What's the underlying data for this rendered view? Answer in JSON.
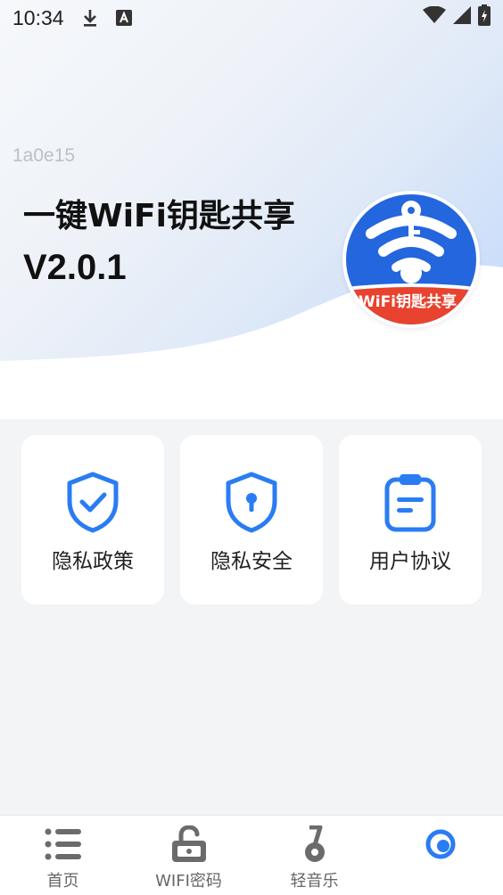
{
  "status_bar": {
    "time": "10:34",
    "icons": [
      "download-icon",
      "a-notification-icon",
      "wifi-icon",
      "signal-icon",
      "battery-icon"
    ]
  },
  "hero": {
    "build_id": "1a0e15",
    "app_title": "一键WiFi钥匙共享",
    "version": "V2.0.1",
    "logo_text": "WiFi钥匙共享"
  },
  "cards": [
    {
      "label": "隐私政策",
      "icon": "shield-check-icon"
    },
    {
      "label": "隐私安全",
      "icon": "shield-lock-icon"
    },
    {
      "label": "用户协议",
      "icon": "clipboard-icon"
    }
  ],
  "bottom_nav": {
    "items": [
      {
        "label": "首页",
        "icon": "list-icon"
      },
      {
        "label": "WIFI密码",
        "icon": "unlock-icon"
      },
      {
        "label": "轻音乐",
        "icon": "music-note-icon"
      },
      {
        "label": "",
        "icon": "profile-ring-icon"
      }
    ]
  },
  "colors": {
    "accent_blue": "#2a7cf3",
    "logo_blue": "#2466dd",
    "logo_red": "#e8432e",
    "nav_gray": "#6b6b6b"
  }
}
